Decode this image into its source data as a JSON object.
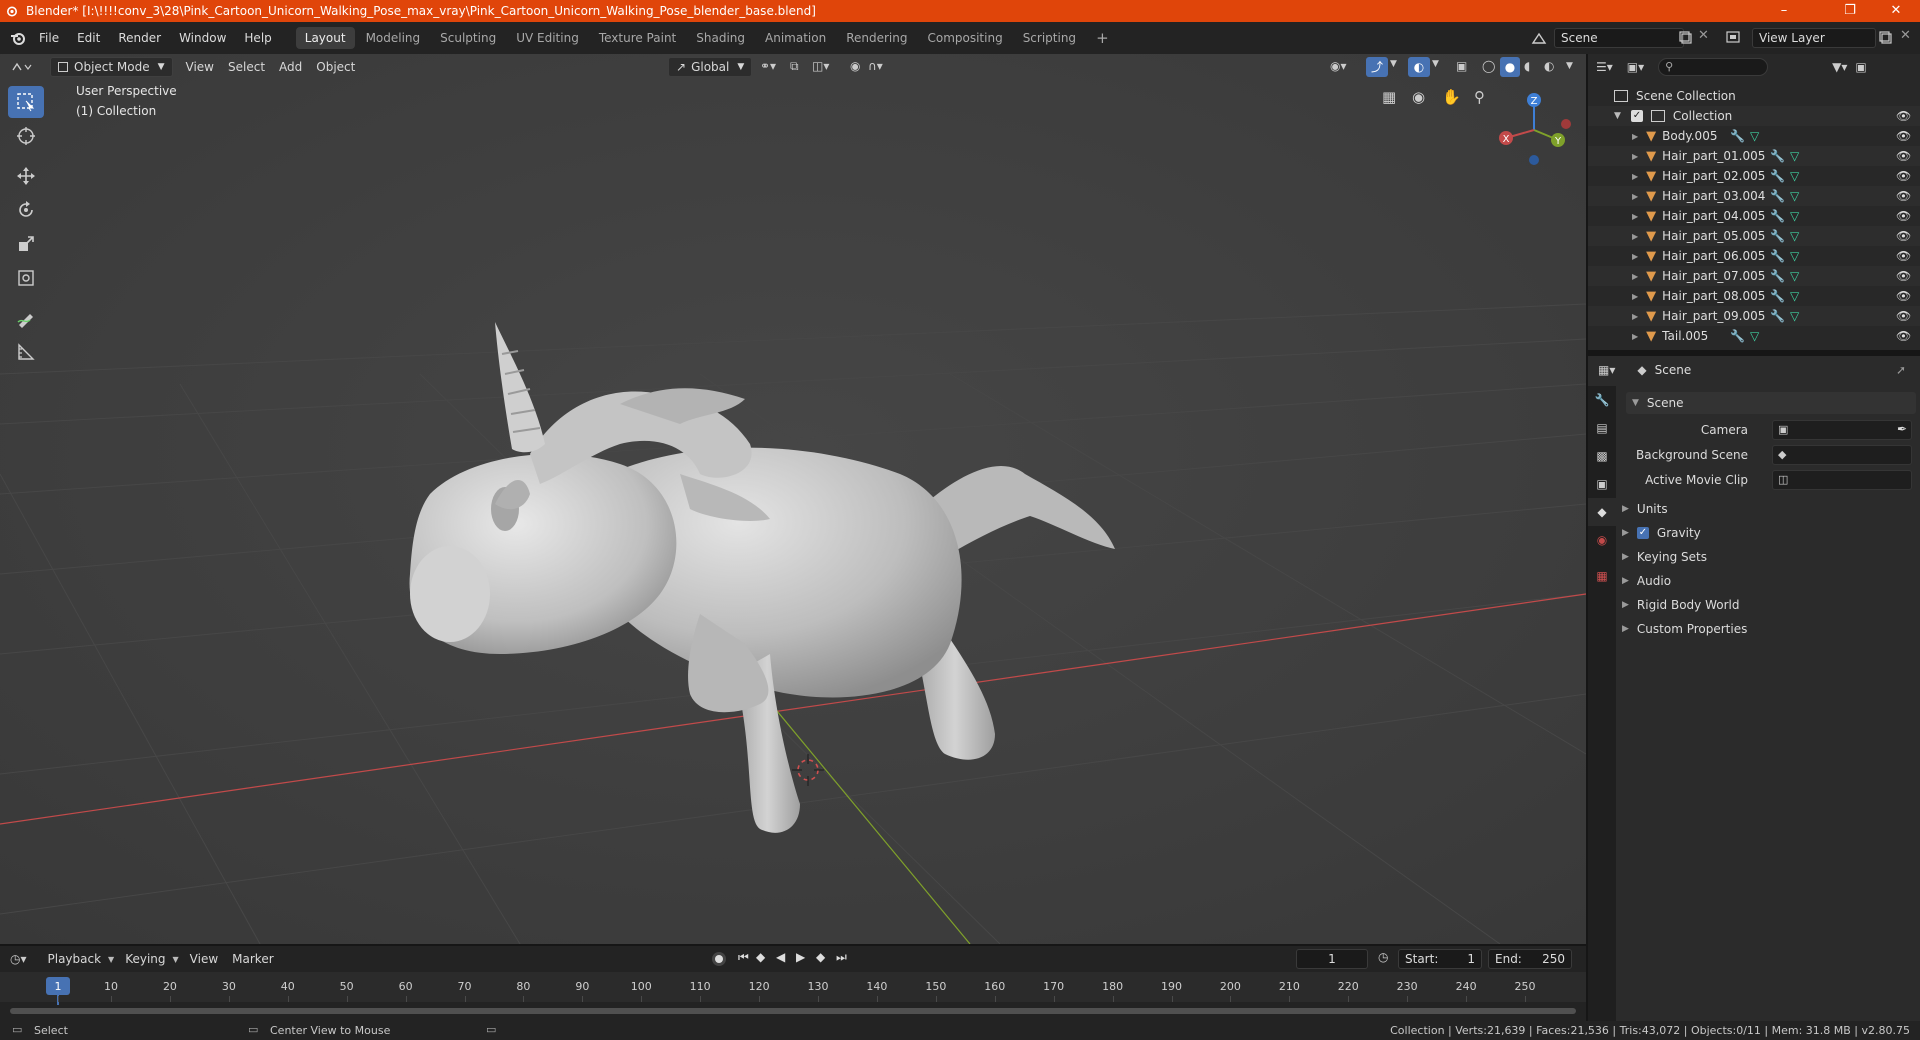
{
  "window": {
    "title": "Blender* [I:\\!!!!conv_3\\28\\Pink_Cartoon_Unicorn_Walking_Pose_max_vray\\Pink_Cartoon_Unicorn_Walking_Pose_blender_base.blend]"
  },
  "menubar": {
    "menus": [
      "File",
      "Edit",
      "Render",
      "Window",
      "Help"
    ],
    "workspaces": [
      "Layout",
      "Modeling",
      "Sculpting",
      "UV Editing",
      "Texture Paint",
      "Shading",
      "Animation",
      "Rendering",
      "Compositing",
      "Scripting"
    ],
    "active_workspace": "Layout",
    "add_tab": "+",
    "scene_name": "Scene",
    "view_layer": "View Layer"
  },
  "viewport": {
    "mode": "Object Mode",
    "menus": [
      "View",
      "Select",
      "Add",
      "Object"
    ],
    "orientation": "Global",
    "overlay_line1": "User Perspective",
    "overlay_line2": "(1) Collection",
    "gizmo_x": "X",
    "gizmo_y": "Y",
    "gizmo_z": "Z"
  },
  "outliner": {
    "root": "Scene Collection",
    "collection": "Collection",
    "objects": [
      "Body.005",
      "Hair_part_01.005",
      "Hair_part_02.005",
      "Hair_part_03.004",
      "Hair_part_04.005",
      "Hair_part_05.005",
      "Hair_part_06.005",
      "Hair_part_07.005",
      "Hair_part_08.005",
      "Hair_part_09.005",
      "Tail.005"
    ]
  },
  "properties": {
    "context": "Scene",
    "panel_title": "Scene",
    "camera_label": "Camera",
    "background_scene_label": "Background Scene",
    "active_movie_clip_label": "Active Movie Clip",
    "sections": [
      "Units",
      "Gravity",
      "Keying Sets",
      "Audio",
      "Rigid Body World",
      "Custom Properties"
    ],
    "gravity_checked": true
  },
  "timeline": {
    "menus": [
      "Playback",
      "Keying",
      "View",
      "Marker"
    ],
    "current_frame": "1",
    "start_label": "Start:",
    "start_value": "1",
    "end_label": "End:",
    "end_value": "250",
    "ticks": [
      "1",
      "10",
      "20",
      "30",
      "40",
      "50",
      "60",
      "70",
      "80",
      "90",
      "100",
      "110",
      "120",
      "130",
      "140",
      "150",
      "160",
      "170",
      "180",
      "190",
      "200",
      "210",
      "220",
      "230",
      "240",
      "250"
    ]
  },
  "statusbar": {
    "left_action": "Select",
    "middle_action": "Center View to Mouse",
    "stats": "Collection | Verts:21,639 | Faces:21,536 | Tris:43,072 | Objects:0/11 | Mem: 31.8 MB | v2.80.75"
  },
  "colors": {
    "titlebar": "#e0450a",
    "accent": "#4772b3",
    "x_axis": "#c24a4a",
    "y_axis": "#7fa12a",
    "z_axis": "#3e7fd6",
    "mesh_icon": "#e09a4c",
    "modifier_icon": "#6a9de0",
    "data_icon": "#3fd0a0"
  }
}
